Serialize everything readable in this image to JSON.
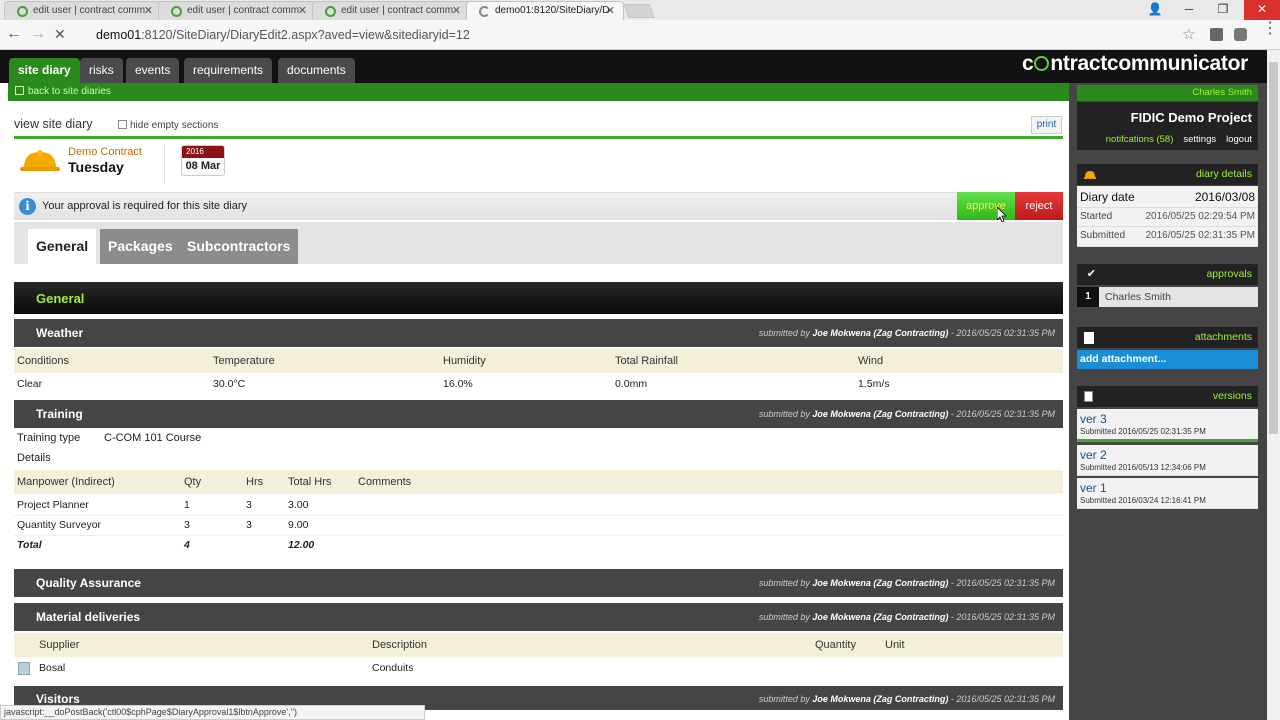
{
  "browser": {
    "tabs": [
      {
        "title": "edit user | contract comm"
      },
      {
        "title": "edit user | contract comm"
      },
      {
        "title": "edit user | contract comm"
      },
      {
        "title": "demo01:8120/SiteDiary/D"
      }
    ],
    "url_host": "demo01",
    "url_rest": ":8120/SiteDiary/DiaryEdit2.aspx?aved=view&sitediaryid=12",
    "status": "javascript:__doPostBack('ctl00$cphPage$DiaryApproval1$lbtnApprove','')"
  },
  "app": {
    "logo_pre": "c",
    "logo_post": "ntractcommunicator",
    "nav": [
      "site diary",
      "risks",
      "events",
      "requirements",
      "documents"
    ],
    "back_link": "back to site diaries"
  },
  "diary": {
    "view_title": "view site diary",
    "hide_empty": "hide empty sections",
    "print": "print",
    "contract": "Demo Contract",
    "day": "Tuesday",
    "year": "2016",
    "date": "08 Mar",
    "approval_msg": "Your approval is required for this site diary",
    "approve": "approve",
    "reject": "reject",
    "tabs": [
      "General",
      "Packages",
      "Subcontractors"
    ],
    "section_title": "General"
  },
  "submitted": {
    "prefix": "submitted by",
    "by": "Joe Mokwena (Zag Contracting)",
    "weather_time": "- 2016/05/25 02:31:35 PM"
  },
  "weather": {
    "title": "Weather",
    "headers": [
      "Conditions",
      "Temperature",
      "Humidity",
      "Total Rainfall",
      "Wind"
    ],
    "values": [
      "Clear",
      "30.0°C",
      "16.0%",
      "0.0mm",
      "1.5m/s"
    ]
  },
  "training": {
    "title": "Training",
    "type_label": "Training type",
    "type_value": "C-COM 101 Course",
    "details": "Details",
    "headers": [
      "Manpower (Indirect)",
      "Qty",
      "Hrs",
      "Total Hrs",
      "Comments"
    ],
    "rows": [
      [
        "Project Planner",
        "1",
        "3",
        "3.00"
      ],
      [
        "Quantity Surveyor",
        "3",
        "3",
        "9.00"
      ]
    ],
    "total": [
      "Total",
      "4",
      "12.00"
    ]
  },
  "qa": {
    "title": "Quality Assurance"
  },
  "materials": {
    "title": "Material deliveries",
    "headers": [
      "Supplier",
      "Description",
      "Quantity",
      "Unit"
    ],
    "rows": [
      [
        "Bosal",
        "Conduits"
      ]
    ]
  },
  "visitors": {
    "title": "Visitors"
  },
  "sidebar": {
    "user": "Charles Smith",
    "project": "FIDIC Demo Project",
    "notifications": "notifcations (58)",
    "settings": "settings",
    "logout": "logout",
    "details_hdr": "diary details",
    "diary_date_label": "Diary date",
    "diary_date": "2016/03/08",
    "started_label": "Started",
    "started": "2016/05/25 02:29:54 PM",
    "submitted_label": "Submitted",
    "submitted": "2016/05/25 02:31:35 PM",
    "approvals_hdr": "approvals",
    "approver_num": "1",
    "approver": "Charles Smith",
    "attachments_hdr": "attachments",
    "add_attachment": "add attachment...",
    "versions_hdr": "versions",
    "versions": [
      {
        "name": "ver 3",
        "sub": "Submitted 2016/05/25 02:31:35 PM"
      },
      {
        "name": "ver 2",
        "sub": "Submitted 2016/05/13 12:34:06 PM"
      },
      {
        "name": "ver 1",
        "sub": "Submitted 2016/03/24 12:16:41 PM"
      }
    ]
  },
  "colors": {
    "brand_green": "#2a8a1c",
    "accent_lime": "#9ef03c",
    "reject_red": "#d02020",
    "link_blue": "#1a8fd8"
  }
}
